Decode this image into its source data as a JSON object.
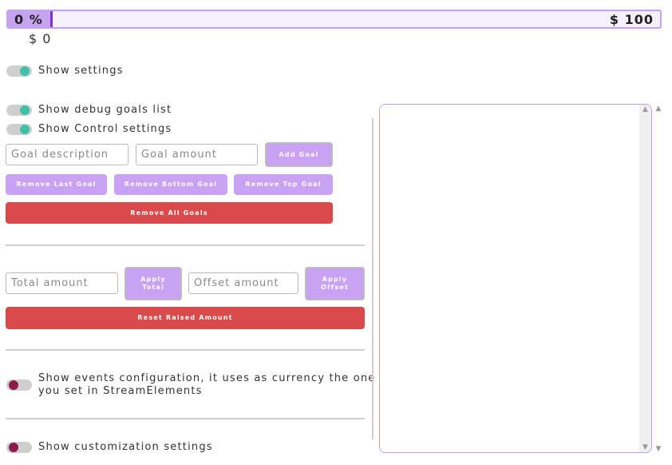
{
  "progress": {
    "percent_label": "0 %",
    "goal_label": "$ 100",
    "fill_fraction": 0.065
  },
  "raised_label": "$ 0",
  "toggles": {
    "show_settings": {
      "label": "Show settings",
      "on": true
    },
    "show_debug": {
      "label": "Show debug goals list",
      "on": true
    },
    "show_control": {
      "label": "Show Control settings",
      "on": true
    },
    "show_events": {
      "label": "Show events configuration, it uses as currency the one you set in StreamElements",
      "line1": "Show events configuration, it uses as currency the one",
      "line2": "you set in StreamElements",
      "on": false
    },
    "show_custom": {
      "label": "Show customization settings",
      "on": false
    }
  },
  "goals": {
    "description_placeholder": "Goal description",
    "amount_placeholder": "Goal amount",
    "add_label": "Add Goal",
    "remove_last_label": "Remove Last Goal",
    "remove_bottom_label": "Remove Bottom Goal",
    "remove_top_label": "Remove Top Goal",
    "remove_all_label": "Remove All Goals"
  },
  "amounts": {
    "total_placeholder": "Total amount",
    "apply_total_line1": "Apply",
    "apply_total_line2": "Total",
    "offset_placeholder": "Offset amount",
    "apply_offset_line1": "Apply",
    "apply_offset_line2": "Offset",
    "reset_label": "Reset Raised Amount"
  },
  "colors": {
    "accent_purple": "#c9a1f5",
    "danger_red": "#d94a4a",
    "toggle_on": "#3ec1a5",
    "toggle_off": "#8a1b4a"
  }
}
